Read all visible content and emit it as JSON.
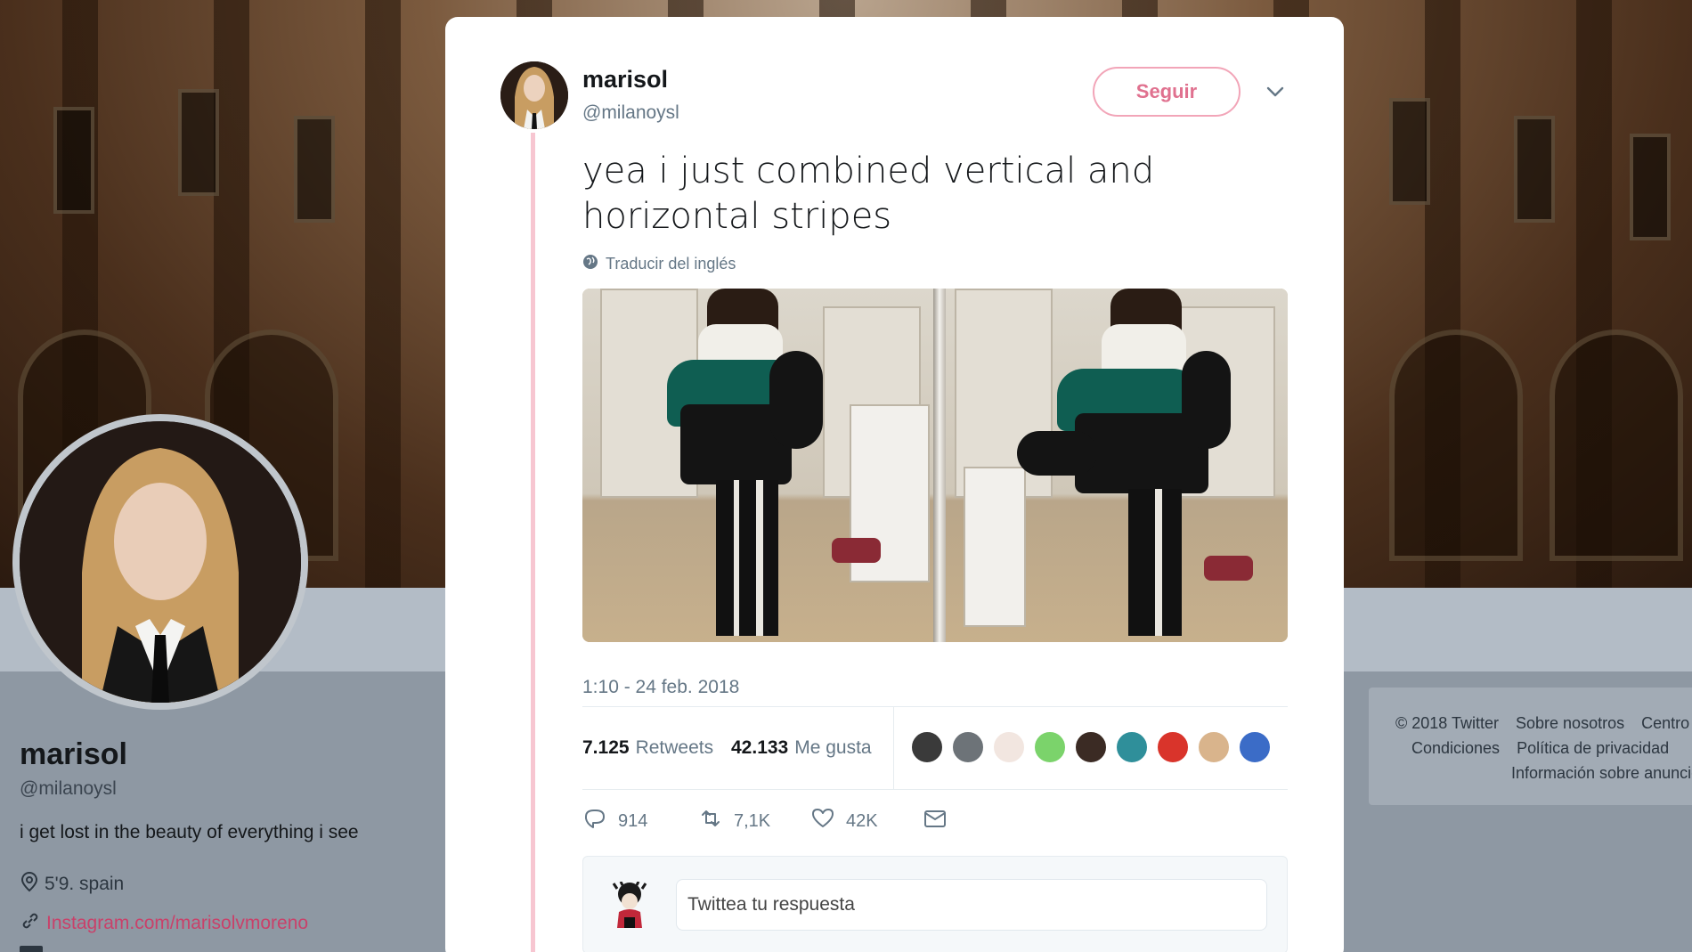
{
  "profile": {
    "name": "marisol",
    "handle": "@milanoysl",
    "bio": "i get lost in the beauty of everything i see",
    "location": "5'9. spain",
    "link": "Instagram.com/marisolvmoreno"
  },
  "footer": {
    "row1": [
      "© 2018 Twitter",
      "Sobre nosotros",
      "Centro"
    ],
    "row2": [
      "Condiciones",
      "Política de privacidad"
    ],
    "row3": [
      "Información sobre anuncios"
    ]
  },
  "tweet": {
    "author_name": "marisol",
    "author_handle": "@milanoysl",
    "follow_label": "Seguir",
    "text": "yea i just combined vertical and horizontal stripes",
    "translate_label": "Traducir del inglés",
    "timestamp": "1:10 - 24 feb. 2018",
    "retweets_count": "7.125",
    "retweets_label": "Retweets",
    "likes_count": "42.133",
    "likes_label": "Me gusta",
    "likers": [
      "#3a3a3a",
      "#6d7378",
      "#f2e6e0",
      "#7bd36b",
      "#3b2b24",
      "#2f8f9a",
      "#d9342b",
      "#d9b48c",
      "#3b6cc7"
    ],
    "actions": {
      "reply_count": "914",
      "retweet_count": "7,1K",
      "like_count": "42K"
    },
    "reply_placeholder": "Twittea tu respuesta"
  },
  "colors": {
    "accent": "#e0718f",
    "thread_line": "#f7c6d1",
    "muted": "#657786"
  }
}
